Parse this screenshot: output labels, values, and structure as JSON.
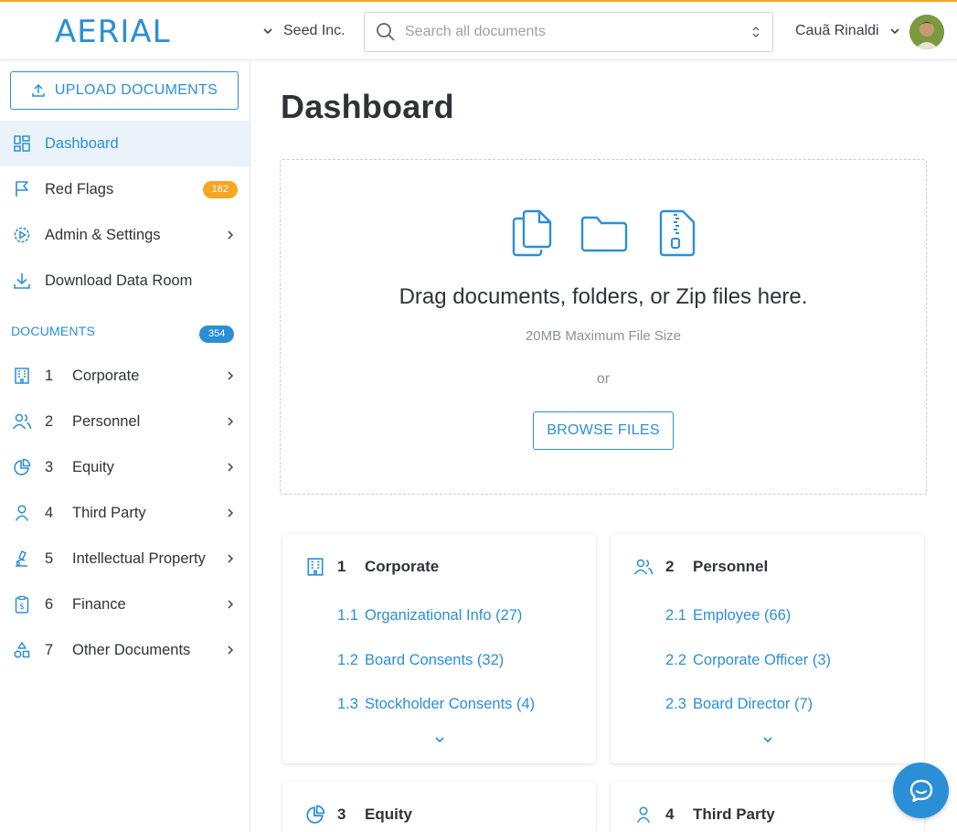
{
  "header": {
    "logo": "AERIAL",
    "company": "Seed Inc.",
    "search_placeholder": "Search all documents",
    "user_name": "Cauã Rinaldi"
  },
  "sidebar": {
    "upload_label": "UPLOAD DOCUMENTS",
    "nav": [
      {
        "label": "Dashboard",
        "icon": "dashboard-icon",
        "active": true
      },
      {
        "label": "Red Flags",
        "icon": "flag-icon",
        "badge": "162"
      },
      {
        "label": "Admin & Settings",
        "icon": "gear-icon"
      },
      {
        "label": "Download Data Room",
        "icon": "download-icon"
      }
    ],
    "documents_header": "DOCUMENTS",
    "documents_count": "354",
    "categories": [
      {
        "num": "1",
        "label": "Corporate",
        "icon": "building-icon"
      },
      {
        "num": "2",
        "label": "Personnel",
        "icon": "people-icon"
      },
      {
        "num": "3",
        "label": "Equity",
        "icon": "pie-chart-icon"
      },
      {
        "num": "4",
        "label": "Third Party",
        "icon": "person-icon"
      },
      {
        "num": "5",
        "label": "Intellectual Property",
        "icon": "microscope-icon"
      },
      {
        "num": "6",
        "label": "Finance",
        "icon": "clipboard-dollar-icon"
      },
      {
        "num": "7",
        "label": "Other Documents",
        "icon": "shapes-icon"
      }
    ]
  },
  "main": {
    "title": "Dashboard",
    "dropzone": {
      "title": "Drag documents, folders, or Zip files here.",
      "subtitle": "20MB Maximum File Size",
      "or": "or",
      "browse_label": "BROWSE FILES"
    },
    "cards": [
      {
        "num": "1",
        "title": "Corporate",
        "icon": "building-icon",
        "items": [
          {
            "num": "1.1",
            "label": "Organizational Info (27)"
          },
          {
            "num": "1.2",
            "label": "Board Consents (32)"
          },
          {
            "num": "1.3",
            "label": "Stockholder Consents (4)"
          }
        ]
      },
      {
        "num": "2",
        "title": "Personnel",
        "icon": "people-icon",
        "items": [
          {
            "num": "2.1",
            "label": "Employee (66)"
          },
          {
            "num": "2.2",
            "label": "Corporate Officer (3)"
          },
          {
            "num": "2.3",
            "label": "Board Director (7)"
          }
        ]
      },
      {
        "num": "3",
        "title": "Equity",
        "icon": "pie-chart-icon",
        "items": []
      },
      {
        "num": "4",
        "title": "Third Party",
        "icon": "person-icon",
        "items": []
      }
    ]
  },
  "colors": {
    "accent": "#2a8fd6",
    "warning": "#f5a623",
    "active_bg": "#eaf3fb"
  }
}
